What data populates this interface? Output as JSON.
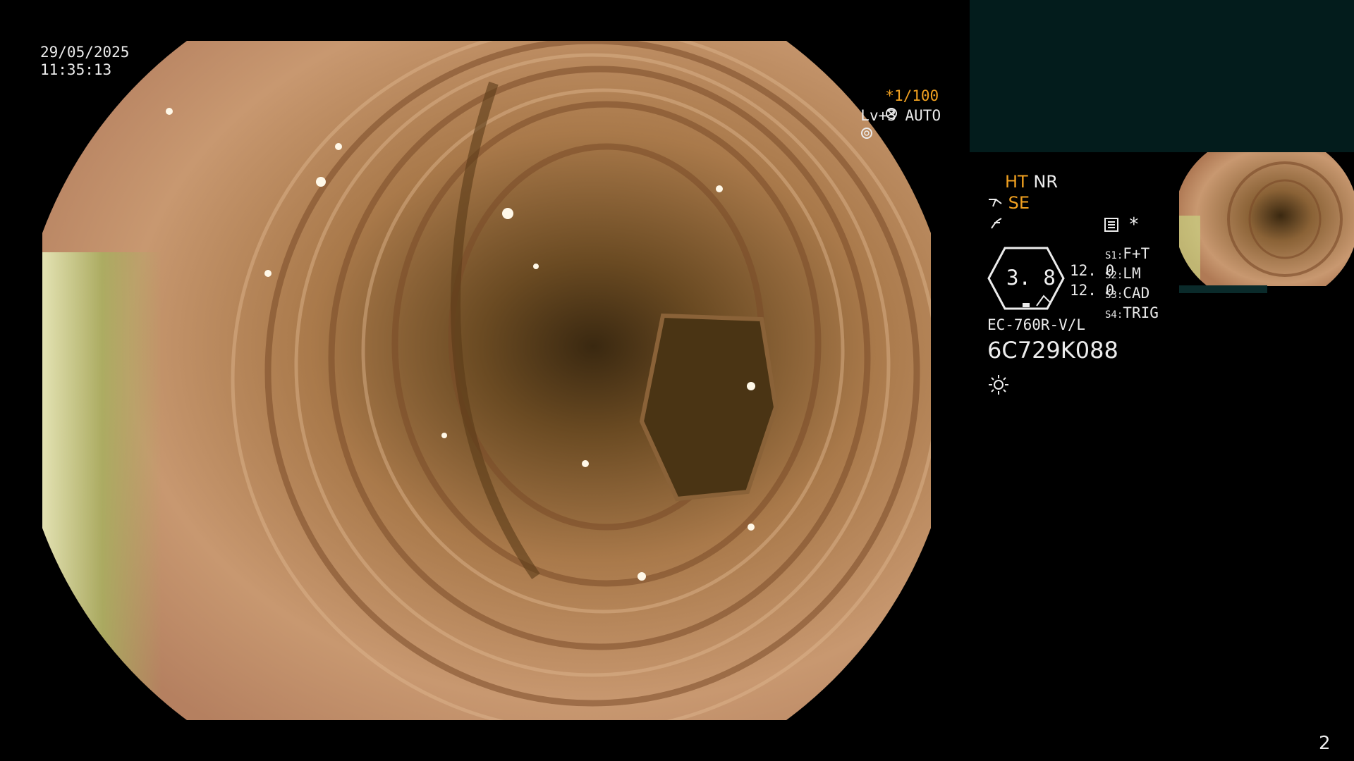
{
  "overlay": {
    "date": "29/05/2025",
    "time": "11:35:13",
    "shutter": "*1/100",
    "level": "Lv+3 AUTO",
    "mode_ht": "HT",
    "mode_nr": "NR",
    "mode_se": "SE",
    "dial_value": "3. 8",
    "side_value_1": "12. 0",
    "side_value_2": "12. 0",
    "s1_label": "S1:",
    "s1_value": "F+T",
    "s2_label": "S2:",
    "s2_value": "LM",
    "s3_label": "S3:",
    "s3_value": "CAD",
    "s4_label": "S4:",
    "s4_value": "TRIG",
    "scope_model": "EC-760R-V/L",
    "serial": "6C729K088",
    "page_number": "2"
  },
  "colors": {
    "accent_orange": "#f0a020",
    "panel_teal": "#031c1c"
  },
  "icons": [
    "shutter-icon",
    "auto-level-icon",
    "se-icon",
    "filter-icon",
    "menu-icon",
    "asterisk-icon",
    "light-icon"
  ]
}
